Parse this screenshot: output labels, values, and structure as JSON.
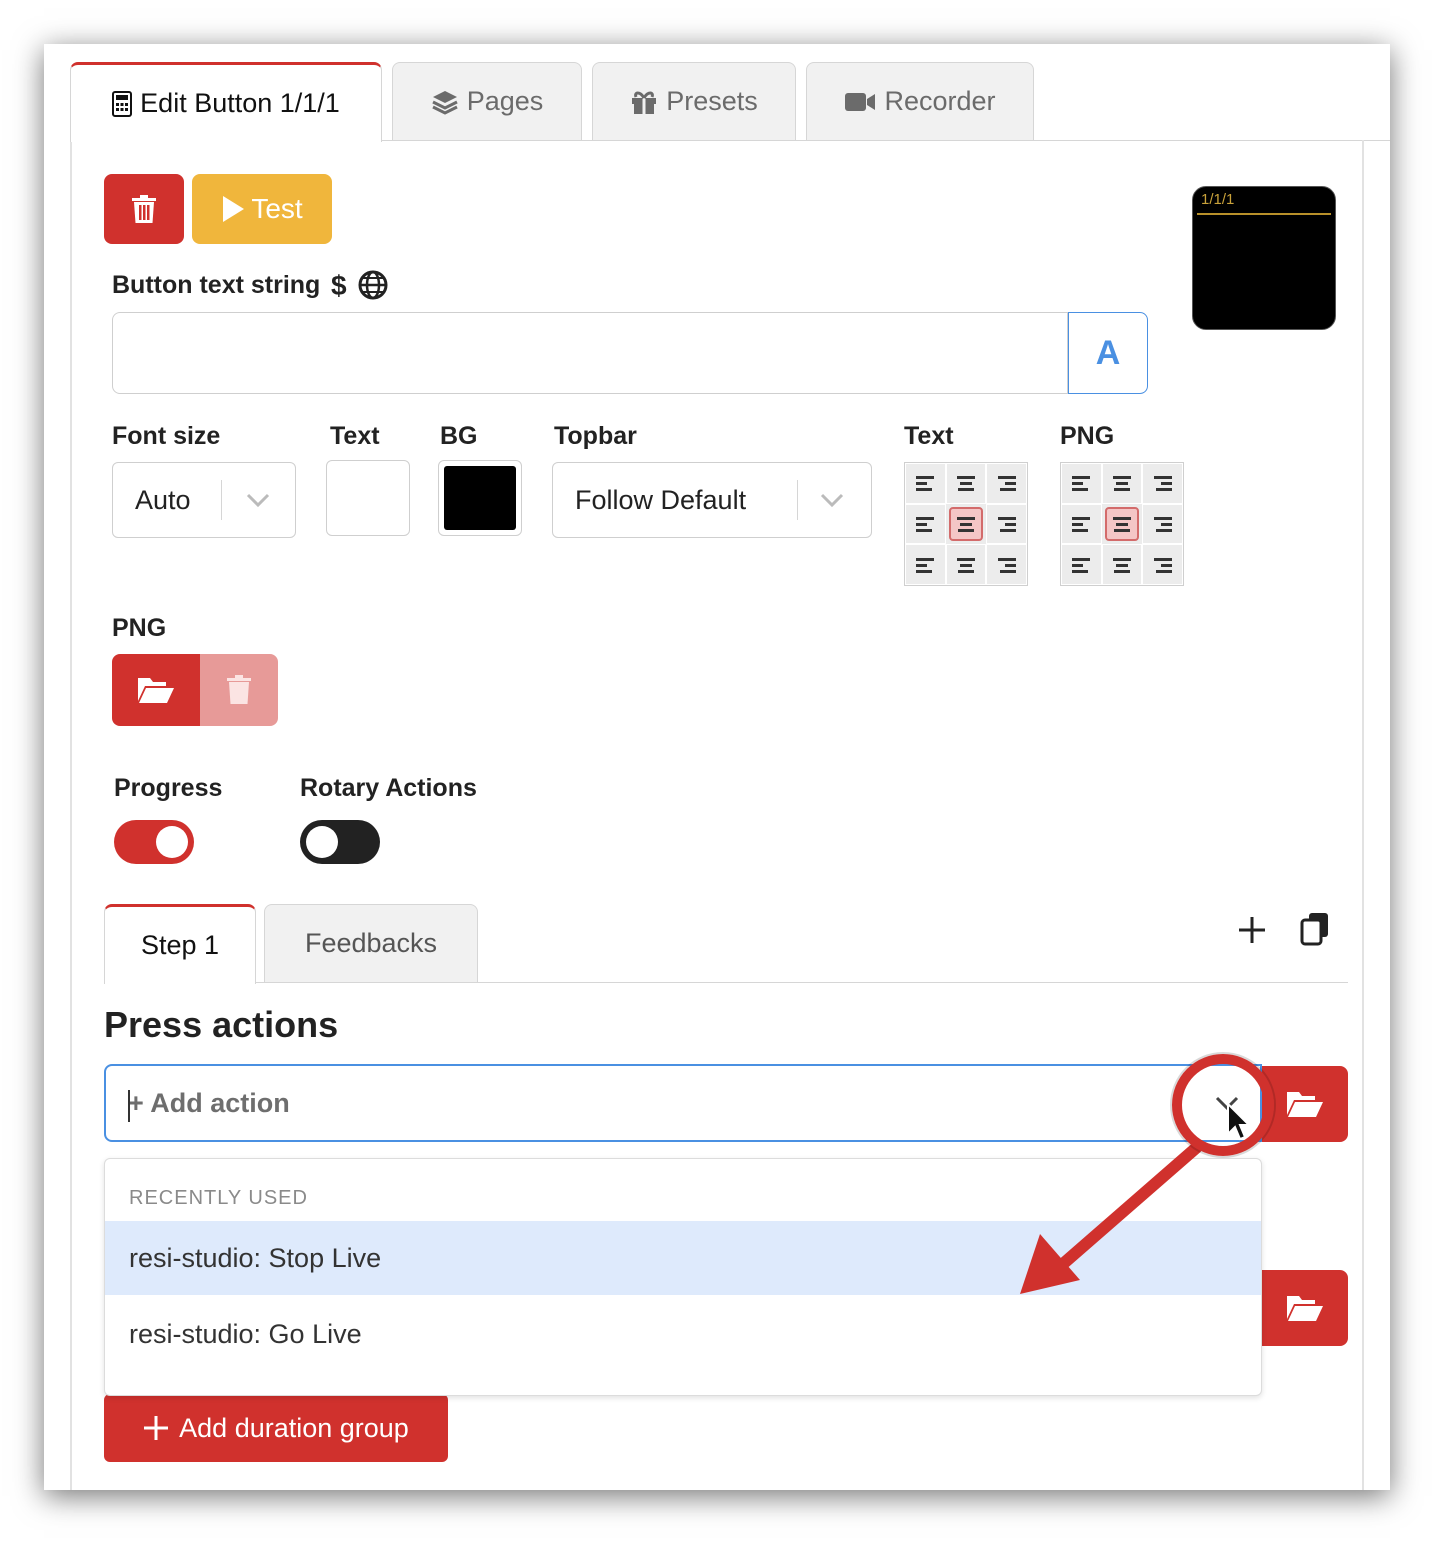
{
  "tabs": [
    {
      "label": "Edit Button 1/1/1",
      "icon": "calculator-icon",
      "active": true
    },
    {
      "label": "Pages",
      "icon": "layers-icon",
      "active": false
    },
    {
      "label": "Presets",
      "icon": "gift-icon",
      "active": false
    },
    {
      "label": "Recorder",
      "icon": "video-camera-icon",
      "active": false
    }
  ],
  "toolbar": {
    "delete_icon": "trash-icon",
    "test_label": "Test"
  },
  "button_text": {
    "label": "Button text string",
    "value": "",
    "addon_label": "A"
  },
  "style": {
    "font_size_label": "Font size",
    "font_size_value": "Auto",
    "text_color_label": "Text",
    "text_color": "#ffffff",
    "bg_color_label": "BG",
    "bg_color": "#000000",
    "topbar_label": "Topbar",
    "topbar_value": "Follow Default",
    "text_align_label": "Text",
    "png_align_label": "PNG"
  },
  "preview": {
    "caption": "1/1/1"
  },
  "png": {
    "label": "PNG"
  },
  "toggles": {
    "progress_label": "Progress",
    "progress_on": true,
    "rotary_label": "Rotary Actions",
    "rotary_on": false
  },
  "step_tabs": [
    {
      "label": "Step 1",
      "active": true
    },
    {
      "label": "Feedbacks",
      "active": false
    }
  ],
  "press_actions": {
    "title": "Press actions",
    "placeholder": "+ Add action",
    "dropdown": {
      "group_label": "RECENTLY USED",
      "items": [
        "resi-studio: Stop Live",
        "resi-studio: Go Live"
      ]
    }
  },
  "add_duration_group": "Add duration group",
  "colors": {
    "accent_red": "#d0312d",
    "test_yellow": "#f0b63c",
    "focus_blue": "#4a90e2",
    "highlight_row": "#deeafc"
  }
}
